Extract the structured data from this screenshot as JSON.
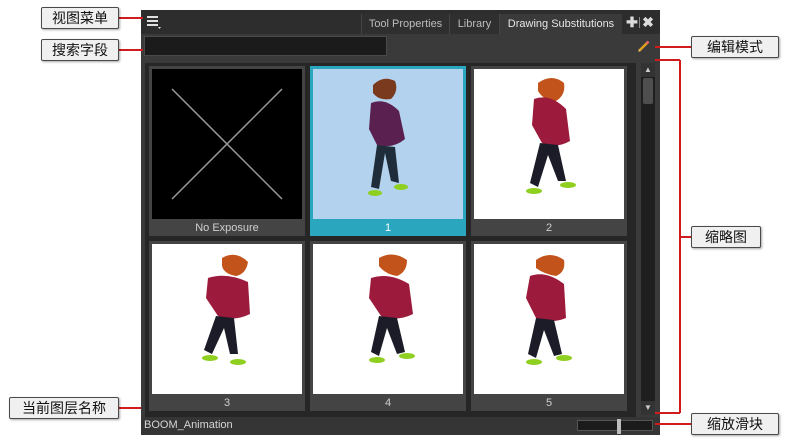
{
  "panel": {
    "tabs": [
      {
        "label": "Tool Properties",
        "active": false
      },
      {
        "label": "Library",
        "active": false
      },
      {
        "label": "Drawing Substitutions",
        "active": true
      }
    ],
    "icons": {
      "view_menu": "menu-icon",
      "add_view": "plus-icon",
      "close_view": "close-icon",
      "edit_mode": "pencil-icon"
    },
    "search": {
      "value": "",
      "placeholder": ""
    },
    "thumbnails": [
      {
        "label": "No Exposure",
        "selected": false,
        "image": "empty-exposure-x"
      },
      {
        "label": "1",
        "selected": true,
        "image": "character-drawing"
      },
      {
        "label": "2",
        "selected": false,
        "image": "character-drawing"
      },
      {
        "label": "3",
        "selected": false,
        "image": "character-drawing"
      },
      {
        "label": "4",
        "selected": false,
        "image": "character-drawing"
      },
      {
        "label": "5",
        "selected": false,
        "image": "character-drawing"
      }
    ],
    "layer_name": "BOOM_Animation",
    "zoom_level": 0.55,
    "scroll_position": 0.0
  },
  "callouts": {
    "view_menu": "视图菜单",
    "search_field": "搜索字段",
    "current_layer_name": "当前图层名称",
    "edit_mode": "编辑模式",
    "thumbnails": "缩略图",
    "zoom_slider": "缩放滑块"
  },
  "colors": {
    "selection": "#2ba6bf",
    "selected_bg": "#b3d2ee",
    "callout_line": "#d01c1c",
    "panel_bg": "#3a3a3a"
  }
}
